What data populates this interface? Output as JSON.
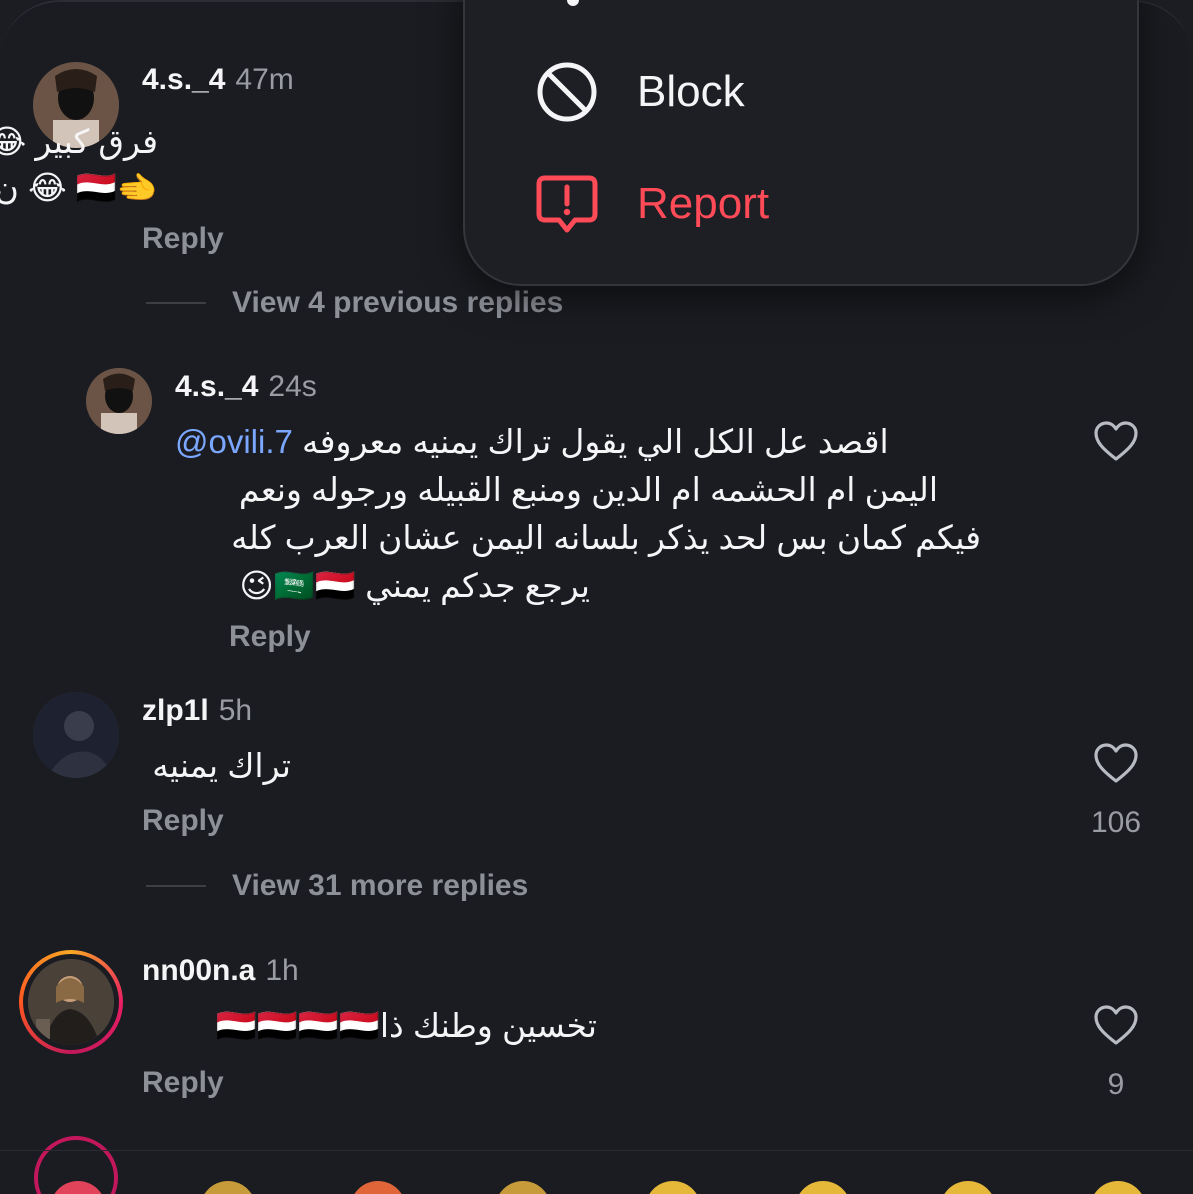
{
  "menu": {
    "block_label": "Block",
    "report_label": "Report",
    "icons": {
      "block": "block-icon",
      "report": "report-icon"
    },
    "colors": {
      "report": "#ff4a57",
      "block": "#f5f5f7"
    }
  },
  "comments": [
    {
      "username": "4.s._4",
      "time": "47m",
      "lines": [
        "فرق كبير 😂😂 خليج",
        "🫲🇾🇪 😂 ن ولخليج"
      ],
      "reply_label": "Reply"
    },
    {
      "username": "4.s._4",
      "time": "24s",
      "mention": "@ovili.7",
      "lines": [
        "اقصد عل الكل الي يقول تراك يمنيه معروفه",
        "اليمن ام الحشمه ام الدين ومنبع القبيله ورجوله ونعم",
        "فيكم كمان بس لحد يذكر بلسانه اليمن عشان العرب كله",
        "يرجع جدكم يمني 🇸🇦🇾🇪😉"
      ],
      "reply_label": "Reply"
    },
    {
      "username": "zlp1l",
      "time": "5h",
      "lines": [
        "تراك يمنيه"
      ],
      "reply_label": "Reply",
      "likes": "106"
    },
    {
      "username": "nn00n.a",
      "time": "1h",
      "lines": [
        "تخسين وطنك ذا🇾🇪🇾🇪🇾🇪🇾🇪"
      ],
      "reply_label": "Reply",
      "likes": "9"
    }
  ],
  "view_previous_replies": "View 4 previous replies",
  "view_more_replies": "View 31 more replies",
  "icons": {
    "like": "heart-icon"
  }
}
